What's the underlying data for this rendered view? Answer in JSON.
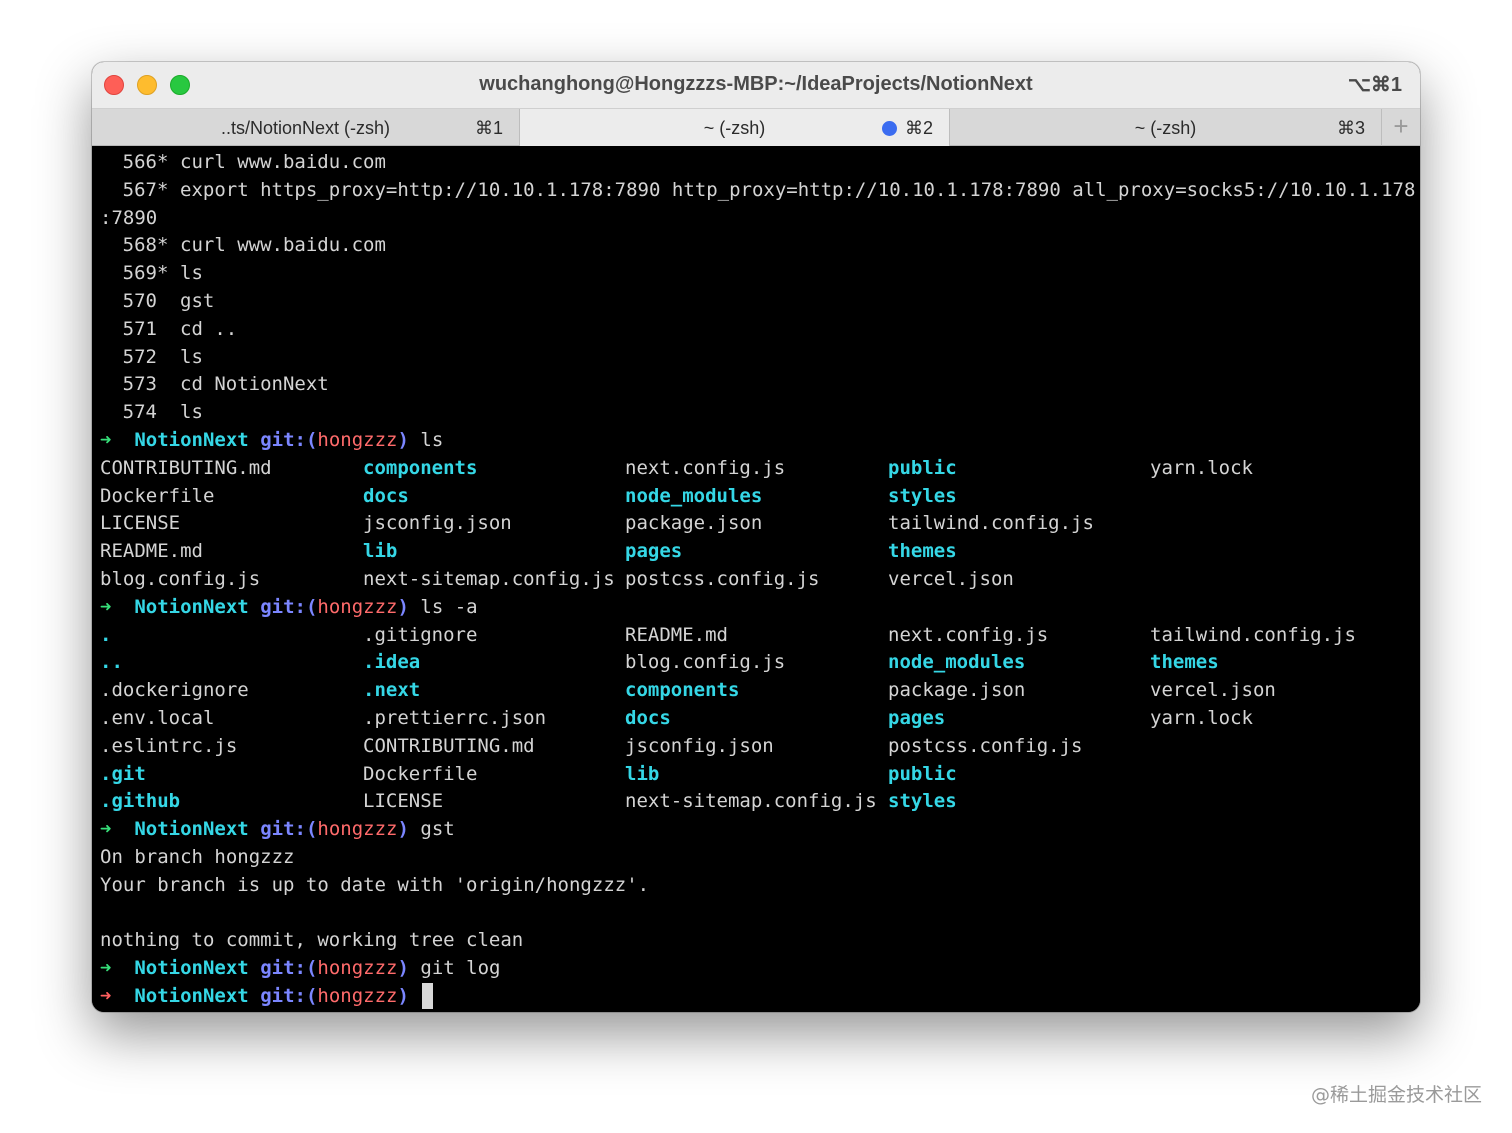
{
  "window": {
    "title": "wuchanghong@Hongzzzs-MBP:~/IdeaProjects/NotionNext",
    "shortcut": "⌥⌘1"
  },
  "tabs": [
    {
      "label": "..ts/NotionNext (-zsh)",
      "shortcut": "⌘1",
      "active": false
    },
    {
      "label": "~ (-zsh)",
      "shortcut": "⌘2",
      "active": true,
      "activity_dot": true
    },
    {
      "label": "~ (-zsh)",
      "shortcut": "⌘3",
      "active": false
    }
  ],
  "new_tab_label": "+",
  "history": [
    {
      "num": "566",
      "star": "*",
      "cmd": "curl www.baidu.com"
    },
    {
      "num": "567",
      "star": "*",
      "cmd": "export https_proxy=http://10.10.1.178:7890 http_proxy=http://10.10.1.178:7890 all_proxy=socks5://10.10.1.178"
    },
    {
      "num": "",
      "star": "",
      "cmd": ":7890",
      "wrap": true
    },
    {
      "num": "568",
      "star": "*",
      "cmd": "curl www.baidu.com"
    },
    {
      "num": "569",
      "star": "*",
      "cmd": "ls"
    },
    {
      "num": "570",
      "star": "",
      "cmd": "gst"
    },
    {
      "num": "571",
      "star": "",
      "cmd": "cd .."
    },
    {
      "num": "572",
      "star": "",
      "cmd": "ls"
    },
    {
      "num": "573",
      "star": "",
      "cmd": "cd NotionNext"
    },
    {
      "num": "574",
      "star": "",
      "cmd": "ls"
    }
  ],
  "prompt": {
    "arrow": "➜",
    "dir": "NotionNext",
    "git_prefix": "git:(",
    "branch": "hongzzz",
    "git_suffix": ")"
  },
  "ls_command": "ls",
  "ls_rows": [
    [
      "CONTRIBUTING.md",
      "components",
      "next.config.js",
      "public",
      "yarn.lock"
    ],
    [
      "Dockerfile",
      "docs",
      "node_modules",
      "styles",
      ""
    ],
    [
      "LICENSE",
      "jsconfig.json",
      "package.json",
      "tailwind.config.js",
      ""
    ],
    [
      "README.md",
      "lib",
      "pages",
      "themes",
      ""
    ],
    [
      "blog.config.js",
      "next-sitemap.config.js",
      "postcss.config.js",
      "vercel.json",
      ""
    ]
  ],
  "ls_dirs": [
    "components",
    "public",
    "docs",
    "node_modules",
    "styles",
    "lib",
    "pages",
    "themes"
  ],
  "lsa_command": "ls -a",
  "lsa_rows": [
    [
      ".",
      ".gitignore",
      "README.md",
      "next.config.js",
      "tailwind.config.js"
    ],
    [
      "..",
      ".idea",
      "blog.config.js",
      "node_modules",
      "themes"
    ],
    [
      ".dockerignore",
      ".next",
      "components",
      "package.json",
      "vercel.json"
    ],
    [
      ".env.local",
      ".prettierrc.json",
      "docs",
      "pages",
      "yarn.lock"
    ],
    [
      ".eslintrc.js",
      "CONTRIBUTING.md",
      "jsconfig.json",
      "postcss.config.js",
      ""
    ],
    [
      ".git",
      "Dockerfile",
      "lib",
      "public",
      ""
    ],
    [
      ".github",
      "LICENSE",
      "next-sitemap.config.js",
      "styles",
      ""
    ]
  ],
  "lsa_dirs": [
    ".",
    "..",
    ".idea",
    ".next",
    ".git",
    ".github",
    "node_modules",
    "themes",
    "components",
    "docs",
    "pages",
    "lib",
    "public",
    "styles"
  ],
  "gst_command": "gst",
  "gst_output": [
    "On branch hongzzz",
    "Your branch is up to date with 'origin/hongzzz'.",
    "",
    "nothing to commit, working tree clean"
  ],
  "gitlog_command": "git log",
  "watermark": "@稀土掘金技术社区",
  "colors": {
    "prompt_arrow_ok": "#37e07a",
    "prompt_arrow_err": "#ff5f5f",
    "dir": "#35d7e6",
    "git": "#7b86ff",
    "branch": "#ff6b6b"
  }
}
